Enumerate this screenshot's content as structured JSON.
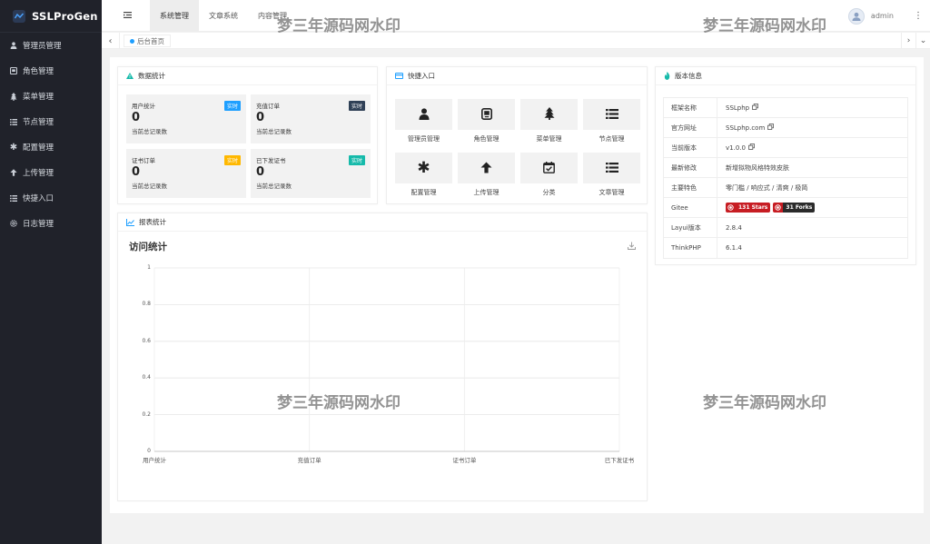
{
  "app": {
    "name": "SSLProGen"
  },
  "sidebar": {
    "items": [
      {
        "label": "管理员管理",
        "icon": "user-icon"
      },
      {
        "label": "角色管理",
        "icon": "id-card-icon"
      },
      {
        "label": "菜单管理",
        "icon": "tree-icon"
      },
      {
        "label": "节点管理",
        "icon": "list-icon"
      },
      {
        "label": "配置管理",
        "icon": "asterisk-icon"
      },
      {
        "label": "上传管理",
        "icon": "arrow-up-icon"
      },
      {
        "label": "快捷入口",
        "icon": "list-icon"
      },
      {
        "label": "日志管理",
        "icon": "gear-icon"
      }
    ]
  },
  "header": {
    "tabs": [
      "系统管理",
      "文章系统",
      "内容管理"
    ],
    "user": "admin"
  },
  "breadcrumb": {
    "label": "后台首页"
  },
  "watermark": "梦三年源码网水印",
  "stats": {
    "title": "数据统计",
    "items": [
      {
        "label": "用户统计",
        "badge": "实时",
        "value": "0",
        "sub": "当前总记录数",
        "color": "#1e9fff"
      },
      {
        "label": "充值订单",
        "badge": "实时",
        "value": "0",
        "sub": "当前总记录数",
        "color": "#2f4056"
      },
      {
        "label": "证书订单",
        "badge": "实时",
        "value": "0",
        "sub": "当前总记录数",
        "color": "#ffb800"
      },
      {
        "label": "已下发证书",
        "badge": "实时",
        "value": "0",
        "sub": "当前总记录数",
        "color": "#16baaa"
      }
    ]
  },
  "quick": {
    "title": "快捷入口",
    "items": [
      {
        "label": "管理员管理",
        "icon": "user-icon"
      },
      {
        "label": "角色管理",
        "icon": "id-card-icon"
      },
      {
        "label": "菜单管理",
        "icon": "tree-icon"
      },
      {
        "label": "节点管理",
        "icon": "list-icon"
      },
      {
        "label": "配置管理",
        "icon": "asterisk-icon"
      },
      {
        "label": "上传管理",
        "icon": "arrow-up-icon"
      },
      {
        "label": "分类",
        "icon": "calendar-check-icon"
      },
      {
        "label": "文章管理",
        "icon": "list-icon"
      }
    ]
  },
  "version": {
    "title": "版本信息",
    "rows": [
      {
        "key": "框架名称",
        "value": "SSLphp",
        "copy": true
      },
      {
        "key": "官方网址",
        "value": "SSLphp.com",
        "copy": true
      },
      {
        "key": "当前版本",
        "value": "v1.0.0",
        "copy": true
      },
      {
        "key": "最新修改",
        "value": "新增拟物风格特效皮肤"
      },
      {
        "key": "主要特色",
        "value": "零门槛 / 响应式 / 清爽 / 极简"
      },
      {
        "key": "Gitee",
        "badges": [
          "131 Stars",
          "31 Forks"
        ]
      },
      {
        "key": "Layui版本",
        "value": "2.8.4"
      },
      {
        "key": "ThinkPHP",
        "value": "6.1.4"
      }
    ]
  },
  "report": {
    "title": "报表统计"
  },
  "chart_data": {
    "type": "bar",
    "title": "访问统计",
    "categories": [
      "用户统计",
      "充值订单",
      "证书订单",
      "已下发证书"
    ],
    "values": [
      0,
      0,
      0,
      0
    ],
    "ylim": [
      0,
      1
    ],
    "yticks": [
      "0",
      "0.2",
      "0.4",
      "0.6",
      "0.8",
      "1"
    ],
    "grid": true,
    "xlabel": "",
    "ylabel": ""
  }
}
